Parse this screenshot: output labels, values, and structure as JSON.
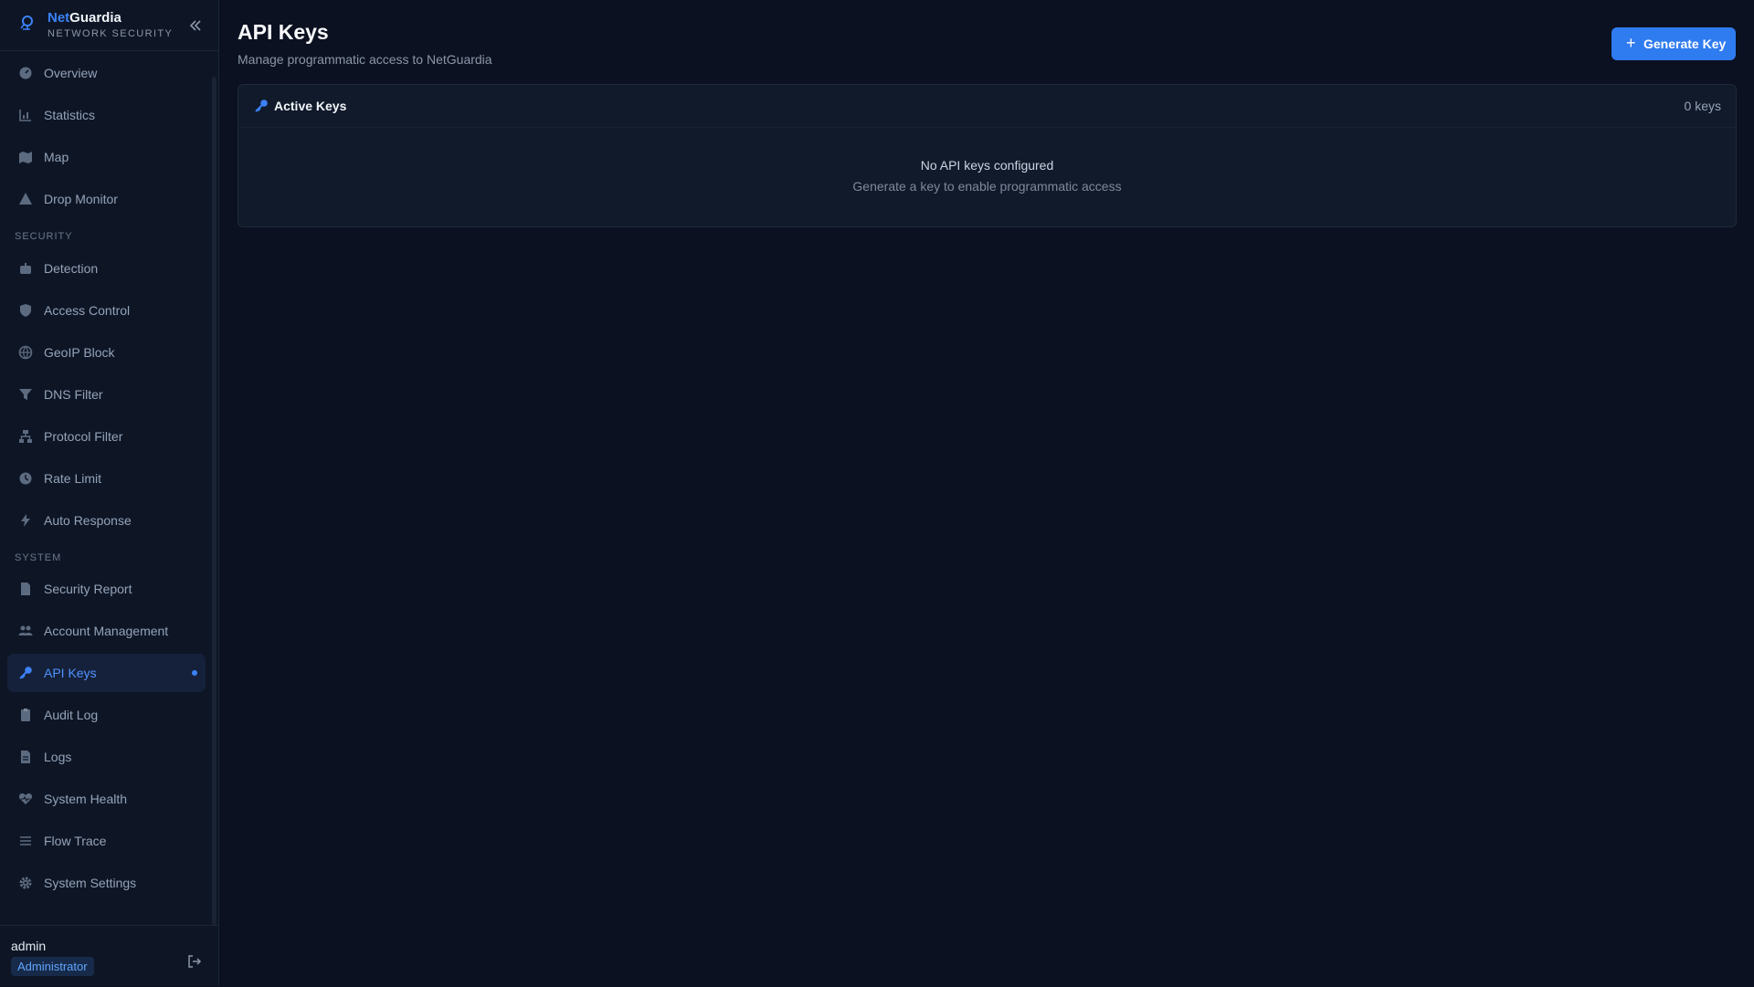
{
  "brand": {
    "name_prefix": "Net",
    "name_suffix": "Guardia",
    "subtitle": "NETWORK SECURITY"
  },
  "sidebar": {
    "items_main": [
      {
        "label": "Overview",
        "icon": "gauge-icon"
      },
      {
        "label": "Statistics",
        "icon": "chart-icon"
      },
      {
        "label": "Map",
        "icon": "map-icon"
      },
      {
        "label": "Drop Monitor",
        "icon": "warning-icon"
      }
    ],
    "section_security": "SECURITY",
    "items_security": [
      {
        "label": "Detection",
        "icon": "robot-icon"
      },
      {
        "label": "Access Control",
        "icon": "shield-icon"
      },
      {
        "label": "GeoIP Block",
        "icon": "globe-icon"
      },
      {
        "label": "DNS Filter",
        "icon": "filter-icon"
      },
      {
        "label": "Protocol Filter",
        "icon": "sitemap-icon"
      },
      {
        "label": "Rate Limit",
        "icon": "clock-icon"
      },
      {
        "label": "Auto Response",
        "icon": "bolt-icon"
      }
    ],
    "section_system": "SYSTEM",
    "items_system": [
      {
        "label": "Security Report",
        "icon": "document-icon"
      },
      {
        "label": "Account Management",
        "icon": "users-icon"
      },
      {
        "label": "API Keys",
        "icon": "key-icon",
        "active": true
      },
      {
        "label": "Audit Log",
        "icon": "clipboard-icon"
      },
      {
        "label": "Logs",
        "icon": "file-icon"
      },
      {
        "label": "System Health",
        "icon": "heart-pulse-icon"
      },
      {
        "label": "Flow Trace",
        "icon": "list-icon"
      },
      {
        "label": "System Settings",
        "icon": "gear-icon"
      }
    ]
  },
  "user": {
    "name": "admin",
    "role": "Administrator"
  },
  "header": {
    "title": "API Keys",
    "subtitle": "Manage programmatic access to NetGuardia",
    "generate_label": "Generate Key"
  },
  "card": {
    "title": "Active Keys",
    "count": "0 keys",
    "empty_title": "No API keys configured",
    "empty_subtitle": "Generate a key to enable programmatic access"
  },
  "colors": {
    "accent": "#2f7bf0",
    "background": "#0b1120",
    "sidebar": "#0e1626"
  }
}
